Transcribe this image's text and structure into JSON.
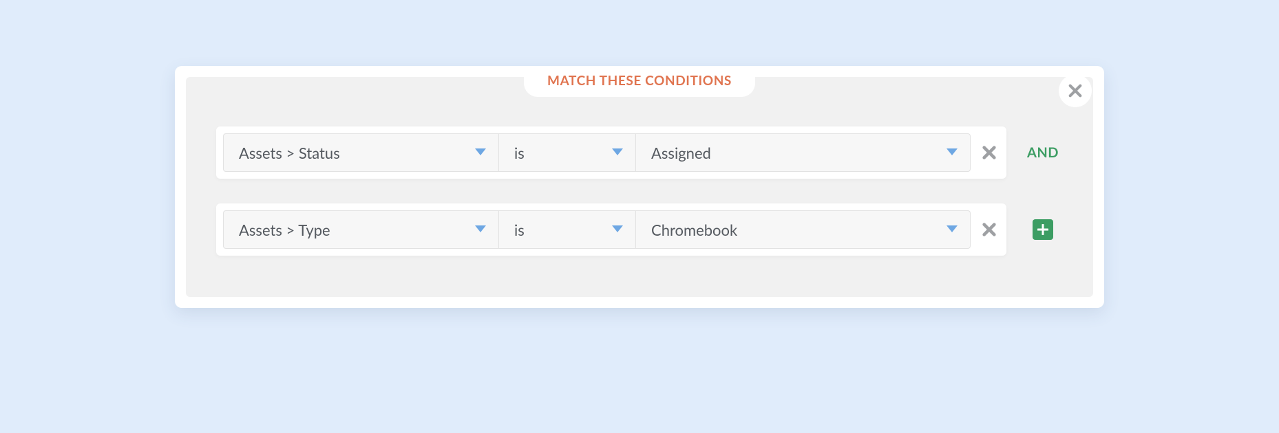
{
  "title": "MATCH THESE CONDITIONS",
  "connector": "AND",
  "conditions": [
    {
      "field": "Assets > Status",
      "operator": "is",
      "value": "Assigned"
    },
    {
      "field": "Assets > Type",
      "operator": "is",
      "value": "Chromebook"
    }
  ],
  "colors": {
    "accent_orange": "#e0744f",
    "accent_green": "#3c9d63",
    "dropdown_caret": "#6ea7e3",
    "icon_grey": "#9ea0a3"
  }
}
